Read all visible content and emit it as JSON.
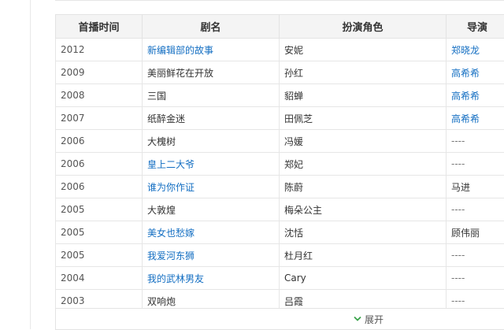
{
  "table": {
    "headers": [
      "首播时间",
      "剧名",
      "扮演角色",
      "导演"
    ],
    "rows": [
      {
        "year": "2012",
        "title": "新编辑部的故事",
        "title_link": true,
        "role": "安妮",
        "director": "郑晓龙",
        "director_link": true
      },
      {
        "year": "2009",
        "title": "美丽鲜花在开放",
        "title_link": false,
        "role": "孙红",
        "director": "高希希",
        "director_link": true
      },
      {
        "year": "2008",
        "title": "三国",
        "title_link": false,
        "role": "貂蝉",
        "director": "高希希",
        "director_link": true
      },
      {
        "year": "2007",
        "title": "纸醉金迷",
        "title_link": false,
        "role": "田佩芝",
        "director": "高希希",
        "director_link": true
      },
      {
        "year": "2006",
        "title": "大槐树",
        "title_link": false,
        "role": "冯媛",
        "director": "----",
        "director_link": false
      },
      {
        "year": "2006",
        "title": "皇上二大爷",
        "title_link": true,
        "role": "郑妃",
        "director": "----",
        "director_link": false
      },
      {
        "year": "2006",
        "title": "谁为你作证",
        "title_link": true,
        "role": "陈蔚",
        "director": "马进",
        "director_link": false
      },
      {
        "year": "2005",
        "title": "大敦煌",
        "title_link": false,
        "role": "梅朵公主",
        "director": "----",
        "director_link": false
      },
      {
        "year": "2005",
        "title": "美女也愁嫁",
        "title_link": true,
        "role": "沈恬",
        "director": "顾伟丽",
        "director_link": false
      },
      {
        "year": "2005",
        "title": "我爱河东狮",
        "title_link": true,
        "role": "杜月红",
        "director": "----",
        "director_link": false
      },
      {
        "year": "2004",
        "title": "我的武林男友",
        "title_link": true,
        "role": "Cary",
        "director": "----",
        "director_link": false
      },
      {
        "year": "2003",
        "title": "双响炮",
        "title_link": false,
        "role": "吕霞",
        "director": "----",
        "director_link": false
      }
    ]
  },
  "footer": {
    "expand_label": "展开",
    "expand_icon": "chevron-down-icon"
  },
  "colors": {
    "link": "#136ec2",
    "header_bg": "#f4f4f4",
    "border": "#e3e3e3",
    "chevron": "#3aa34a"
  }
}
